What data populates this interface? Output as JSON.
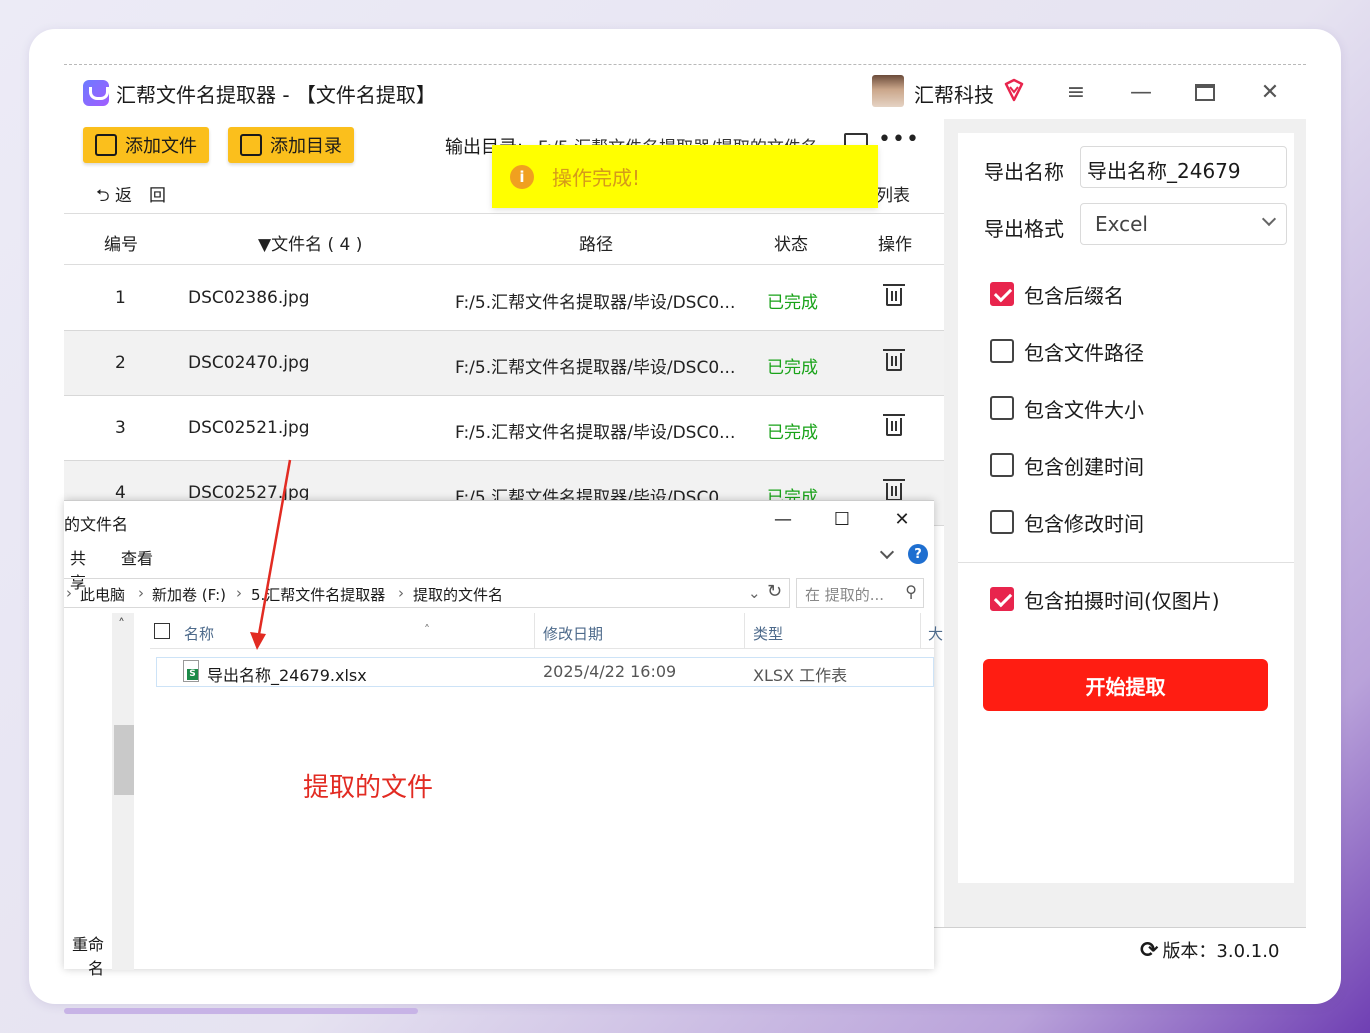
{
  "app": {
    "title": "汇帮文件名提取器 - 【文件名提取】",
    "brand": "汇帮科技",
    "colors": {
      "accent_yellow": "#fbbf1c",
      "start_red": "#ff1d12",
      "checkbox_red": "#e8254d",
      "status_green": "#19a319",
      "toast_yellow": "#ffff00"
    }
  },
  "toolbar": {
    "add_file": "添加文件",
    "add_dir": "添加目录",
    "output_label": "输出目录:",
    "output_value": "F:/5.汇帮文件名提取器/提取的文件名",
    "back": "返　回",
    "list": "列表"
  },
  "toast": {
    "message": "操作完成!"
  },
  "table": {
    "headers": {
      "num": "编号",
      "name": "▼文件名 ( 4 )",
      "path": "路径",
      "status": "状态",
      "action": "操作"
    },
    "rows": [
      {
        "num": "1",
        "name": "DSC02386.jpg",
        "path": "F:/5.汇帮文件名提取器/毕设/DSC0...",
        "status": "已完成"
      },
      {
        "num": "2",
        "name": "DSC02470.jpg",
        "path": "F:/5.汇帮文件名提取器/毕设/DSC0...",
        "status": "已完成"
      },
      {
        "num": "3",
        "name": "DSC02521.jpg",
        "path": "F:/5.汇帮文件名提取器/毕设/DSC0...",
        "status": "已完成"
      },
      {
        "num": "4",
        "name": "DSC02527.jpg",
        "path": "F:/5.汇帮文件名提取器/毕设/DSC0...",
        "status": "已完成"
      }
    ]
  },
  "settings": {
    "export_name_label": "导出名称",
    "export_name_value": "导出名称_24679",
    "export_format_label": "导出格式",
    "export_format_value": "Excel",
    "options": [
      {
        "label": "包含后缀名",
        "checked": true
      },
      {
        "label": "包含文件路径",
        "checked": false
      },
      {
        "label": "包含文件大小",
        "checked": false
      },
      {
        "label": "包含创建时间",
        "checked": false
      },
      {
        "label": "包含修改时间",
        "checked": false
      }
    ],
    "photo_option": {
      "label": "包含拍摄时间(仅图片)",
      "checked": true
    },
    "start_button": "开始提取",
    "version": "版本：3.0.1.0"
  },
  "explorer": {
    "title": "的文件名",
    "menu_share": "共享",
    "menu_view": "查看",
    "breadcrumb": [
      "此电脑",
      "新加卷 (F:)",
      "5.汇帮文件名提取器",
      "提取的文件名"
    ],
    "search_placeholder": "在 提取的...",
    "columns": {
      "name": "名称",
      "modified": "修改日期",
      "type": "类型",
      "size": "大"
    },
    "file": {
      "name": "导出名称_24679.xlsx",
      "modified": "2025/4/22 16:09",
      "type": "XLSX 工作表"
    },
    "rename": "重命名"
  },
  "annotation": "提取的文件"
}
